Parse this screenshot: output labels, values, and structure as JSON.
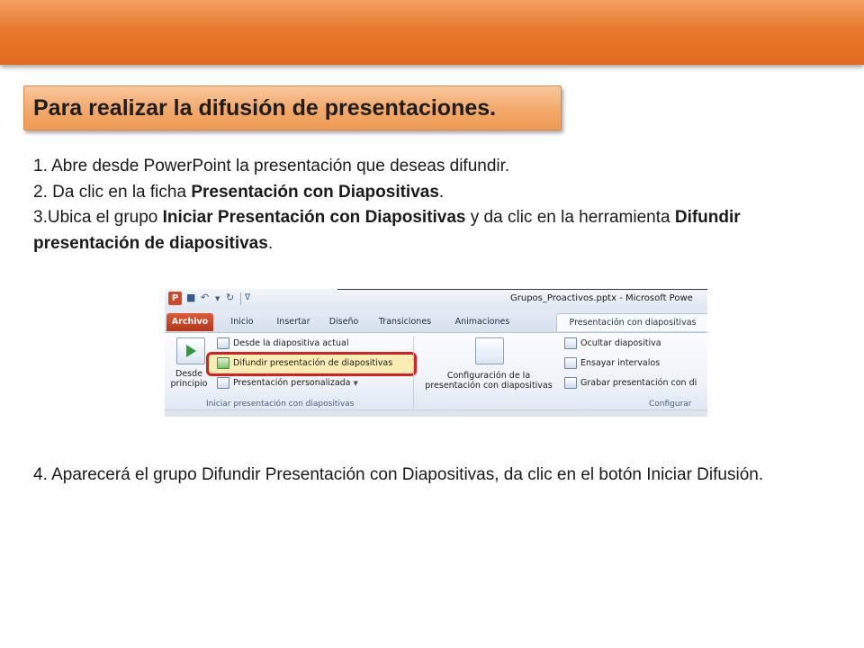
{
  "header": {
    "accent": "#e87a2f"
  },
  "title": "Para realizar la difusión de presentaciones.",
  "steps": {
    "s1": "1. Abre desde PowerPoint la presentación que deseas difundir.",
    "s2_pre": "2. Da clic en la ficha ",
    "s2_bold": "Presentación con Diapositivas",
    "s2_post": ".",
    "s3_pre": "3.Ubica el grupo ",
    "s3_bold": "Iniciar Presentación con Diapositivas",
    "s3_mid": " y da clic en la herramienta ",
    "s3_bold2": "Difundir presentación de diapositivas",
    "s3_post": ".",
    "s4": "4. Aparecerá el grupo Difundir Presentación con Diapositivas, da clic en el botón Iniciar Difusión."
  },
  "screenshot": {
    "doc_title": "Grupos_Proactivos.pptx - Microsoft Powe",
    "app_icon": "P",
    "tabs": [
      "Archivo",
      "Inicio",
      "Insertar",
      "Diseño",
      "Transiciones",
      "Animaciones",
      "Presentación con diapositivas"
    ],
    "group1": {
      "big_button_line1": "Desde",
      "big_button_line2": "principio",
      "item1": "Desde la diapositiva actual",
      "item2": "Difundir presentación de diapositivas",
      "item3": "Presentación personalizada",
      "label": "Iniciar presentación con diapositivas"
    },
    "group2": {
      "line1": "Configuración de la",
      "line2": "presentación con diapositivas"
    },
    "group3": {
      "item1": "Ocultar diapositiva",
      "item2": "Ensayar intervalos",
      "item3": "Grabar presentación con di",
      "label": "Configurar"
    },
    "highlight_color": "#d81e1e"
  }
}
